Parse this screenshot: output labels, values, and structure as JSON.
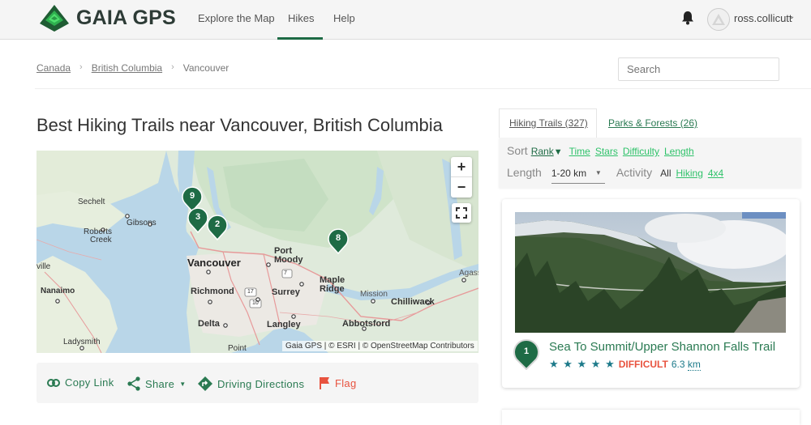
{
  "header": {
    "brand": "GAIA GPS",
    "nav": [
      {
        "label": "Explore the Map"
      },
      {
        "label": "Hikes",
        "active": true
      },
      {
        "label": "Help"
      }
    ],
    "username": "ross.collicutt",
    "accent_color": "#1e6b45"
  },
  "breadcrumb": {
    "items": [
      {
        "label": "Canada",
        "link": true
      },
      {
        "label": "British Columbia",
        "link": true
      },
      {
        "label": "Vancouver",
        "link": false
      }
    ],
    "separator": "›"
  },
  "search": {
    "placeholder": "Search",
    "value": ""
  },
  "page_title": "Best Hiking Trails near Vancouver, British Columbia",
  "map": {
    "zoom_in": "+",
    "zoom_out": "−",
    "attribution": "Gaia GPS | © ESRI | © OpenStreetMap Contributors",
    "places": {
      "sechelt": "Sechelt",
      "gibsons": "Gibsons",
      "roberts_creek_1": "Roberts",
      "roberts_creek_2": "Creek",
      "ville": "ville",
      "nanaimo": "Nanaimo",
      "ladysmith": "Ladysmith",
      "vancouver": "Vancouver",
      "richmond": "Richmond",
      "delta": "Delta",
      "point": "Point",
      "port_moody_1": "Port",
      "port_moody_2": "Moody",
      "surrey": "Surrey",
      "maple_ridge_1": "Maple",
      "maple_ridge_2": "Ridge",
      "langley": "Langley",
      "mission": "Mission",
      "abbotsford": "Abbotsford",
      "chilliwack": "Chilliwack",
      "agassiz": "Agass"
    },
    "highway_shields": [
      "7",
      "17",
      "10"
    ],
    "markers": [
      {
        "label": "9"
      },
      {
        "label": "3"
      },
      {
        "label": "2"
      },
      {
        "label": "8"
      }
    ]
  },
  "actions": {
    "copy_link": "Copy Link",
    "share": "Share",
    "driving_directions": "Driving Directions",
    "flag": "Flag"
  },
  "tabs": [
    {
      "label": "Hiking Trails (327)",
      "active": true
    },
    {
      "label": "Parks & Forests (26)",
      "active": false
    }
  ],
  "filters": {
    "sort_label": "Sort",
    "sort_options": [
      {
        "label": "Rank",
        "active": true,
        "indicator": "▼"
      },
      {
        "label": "Time"
      },
      {
        "label": "Stars"
      },
      {
        "label": "Difficulty"
      },
      {
        "label": "Length"
      }
    ],
    "length_label": "Length",
    "length_value": "1-20 km",
    "activity_label": "Activity",
    "activity_options": [
      {
        "label": "All",
        "active": true
      },
      {
        "label": "Hiking"
      },
      {
        "label": "4x4"
      }
    ]
  },
  "trails": [
    {
      "rank": "1",
      "name": "Sea To Summit/Upper Shannon Falls Trail",
      "stars": 5,
      "stars_display": "★ ★ ★ ★ ★",
      "difficulty": "DIFFICULT",
      "distance_value": "6.3",
      "distance_unit": "km"
    }
  ]
}
